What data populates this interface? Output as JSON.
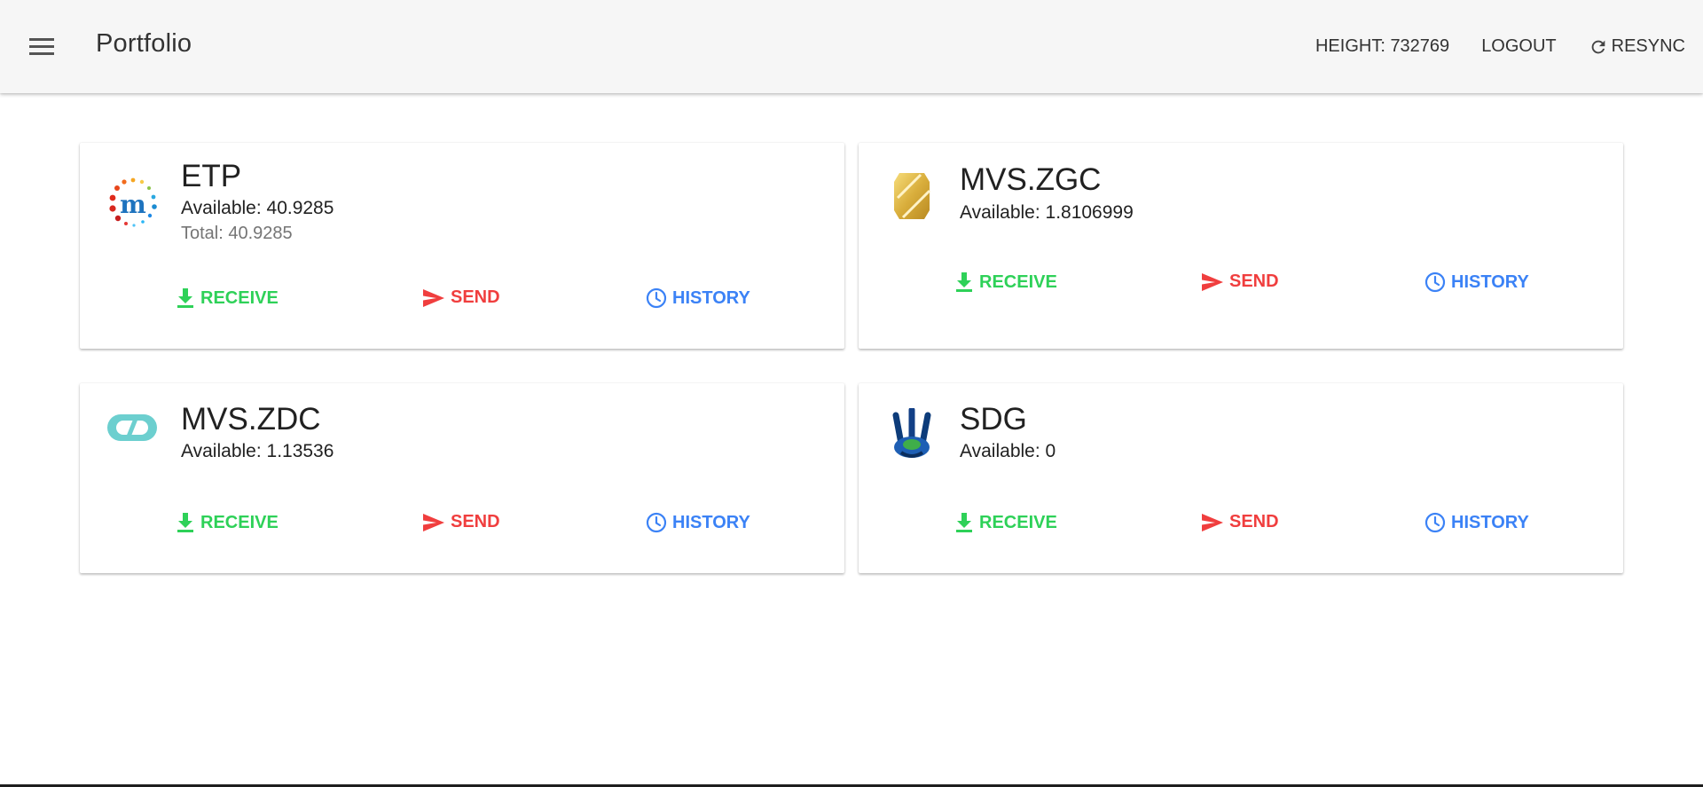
{
  "toolbar": {
    "title": "Portfolio",
    "height_label": "HEIGHT: 732769",
    "logout_label": "LOGOUT",
    "resync_label": "RESYNC"
  },
  "assets": [
    {
      "name": "ETP",
      "available": "Available: 40.9285",
      "total": "Total: 40.9285",
      "logo_icon": "metaverse-etp-logo",
      "receive_label": "RECEIVE",
      "send_label": "SEND",
      "history_label": "HISTORY"
    },
    {
      "name": "MVS.ZGC",
      "available": "Available: 1.8106999",
      "logo_icon": "zgc-gold-logo",
      "receive_label": "RECEIVE",
      "send_label": "SEND",
      "history_label": "HISTORY"
    },
    {
      "name": "MVS.ZDC",
      "available": "Available: 1.13536",
      "logo_icon": "zdc-capsule-logo",
      "receive_label": "RECEIVE",
      "send_label": "SEND",
      "history_label": "HISTORY"
    },
    {
      "name": "SDG",
      "available": "Available: 0",
      "logo_icon": "sdg-hands-logo",
      "receive_label": "RECEIVE",
      "send_label": "SEND",
      "history_label": "HISTORY"
    }
  ],
  "colors": {
    "receive": "#2ed158",
    "send": "#f03e3e",
    "history": "#3b82f6",
    "toolbar_bg": "#f6f6f6"
  }
}
